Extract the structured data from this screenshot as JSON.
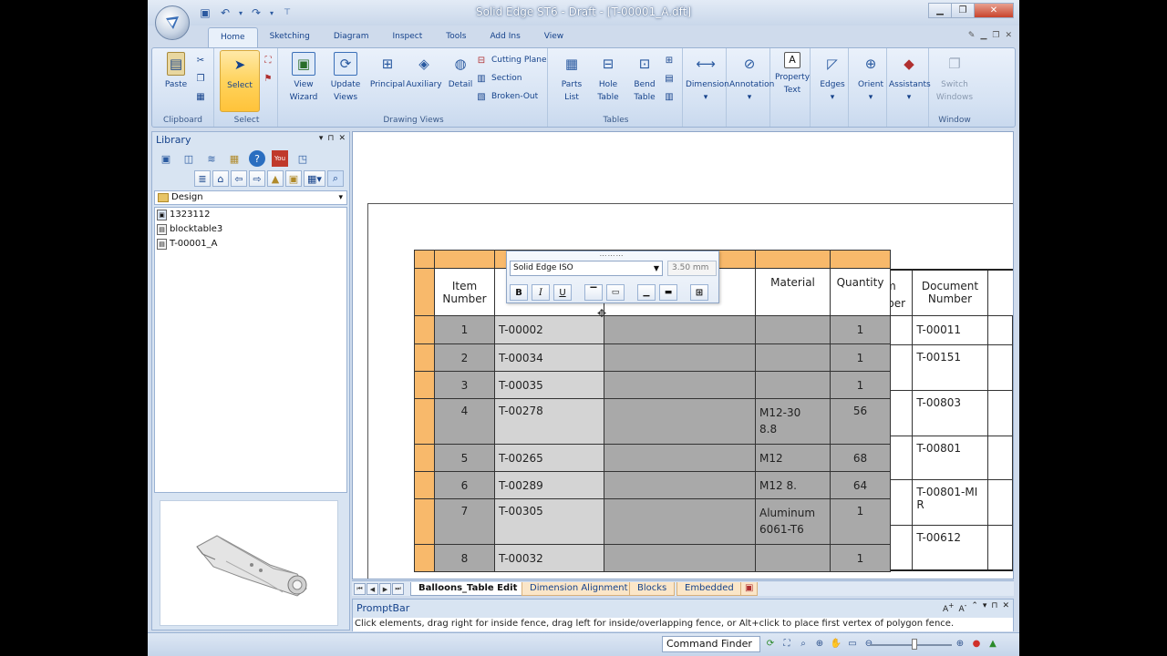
{
  "window": {
    "title": "Solid Edge ST6 - Draft - [T-00001_A.dft]",
    "minimize": "▁",
    "restore": "❐",
    "close": "✕"
  },
  "tabs": [
    "Home",
    "Sketching",
    "Diagram",
    "Inspect",
    "Tools",
    "Add Ins",
    "View"
  ],
  "ribbon": {
    "clipboard": {
      "label": "Clipboard",
      "paste": "Paste"
    },
    "select": {
      "label": "Select",
      "select": "Select"
    },
    "drawing_views": {
      "label": "Drawing Views",
      "view_wizard": [
        "View",
        "Wizard"
      ],
      "update_views": [
        "Update",
        "Views"
      ],
      "principal": "Principal",
      "auxiliary": "Auxiliary",
      "detail": "Detail",
      "cutting_plane": "Cutting Plane",
      "section": "Section",
      "broken_out": "Broken-Out"
    },
    "tables": {
      "label": "Tables",
      "parts_list": [
        "Parts",
        "List"
      ],
      "hole_table": [
        "Hole",
        "Table"
      ],
      "bend_table": [
        "Bend",
        "Table"
      ]
    },
    "dimension": "Dimension",
    "annotation": "Annotation",
    "property_text": [
      "Property",
      "Text"
    ],
    "edges": "Edges",
    "orient": "Orient",
    "assistants": "Assistants",
    "window": {
      "label": "Window",
      "switch_windows": [
        "Switch",
        "Windows"
      ]
    }
  },
  "library": {
    "title": "Library",
    "folder": "Design",
    "items": [
      "1323112",
      "blocktable3",
      "T-00001_A"
    ]
  },
  "mini_toolbar": {
    "font": "Solid Edge ISO",
    "size": "3.50 mm",
    "bold": "B",
    "italic": "I",
    "underline": "U"
  },
  "bom_table": {
    "headers": {
      "item_number": [
        "Item",
        "Number"
      ],
      "material": "Material",
      "quantity": "Quantity"
    },
    "rows": [
      {
        "item": "1",
        "doc": "T-00002",
        "material": "",
        "qty": "1"
      },
      {
        "item": "2",
        "doc": "T-00034",
        "material": "",
        "qty": "1"
      },
      {
        "item": "3",
        "doc": "T-00035",
        "material": "",
        "qty": "1"
      },
      {
        "item": "4",
        "doc": "T-00278",
        "material": [
          "M12-30",
          "8.8"
        ],
        "qty": "56"
      },
      {
        "item": "5",
        "doc": "T-00265",
        "material": "M12",
        "qty": "68"
      },
      {
        "item": "6",
        "doc": "T-00289",
        "material": "M12  8.",
        "qty": "64"
      },
      {
        "item": "7",
        "doc": "T-00305",
        "material": [
          "Aluminum",
          "6061-T6"
        ],
        "qty": "1"
      },
      {
        "item": "8",
        "doc": "T-00032",
        "material": "",
        "qty": "1"
      }
    ]
  },
  "right_table": {
    "headers": {
      "item_number": [
        "Item",
        "Number"
      ],
      "document_number": [
        "Document",
        "Number"
      ]
    },
    "docs": [
      "T-00011",
      "T-00151",
      "T-00803",
      "T-00801",
      "T-00801-MI",
      "R",
      "T-00612"
    ]
  },
  "sheet_tabs": [
    "Balloons_Table Edit",
    "Dimension Alignment",
    "Blocks",
    "Embedded"
  ],
  "promptbar": {
    "title": "PromptBar",
    "text": "Click elements, drag right for inside fence, drag left for inside/overlapping fence, or Alt+click to place first vertex of polygon fence."
  },
  "status": {
    "command_finder": "Command Finder"
  },
  "colors": {
    "table_highlight": "#f8b96b",
    "cell_gray": "#a9a9a9",
    "cell_light": "#d4d4d4"
  }
}
